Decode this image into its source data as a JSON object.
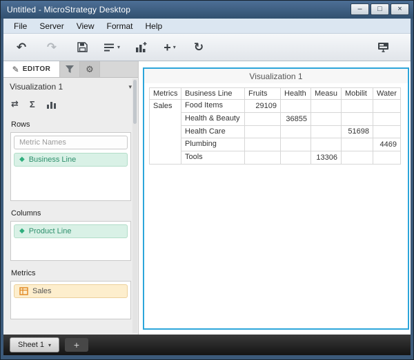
{
  "window": {
    "title": "Untitled - MicroStrategy Desktop",
    "controls": {
      "minimize": "–",
      "maximize": "□",
      "close": "×"
    }
  },
  "menu": {
    "items": [
      "File",
      "Server",
      "View",
      "Format",
      "Help"
    ]
  },
  "toolbar": {
    "icons": [
      "back",
      "forward",
      "save",
      "dataset",
      "insert-visualization",
      "add",
      "refresh",
      "presentation"
    ]
  },
  "icons": {
    "caret_down": "▾",
    "diamond": "◆",
    "pencil": "✎",
    "gear": "⚙",
    "back_arrow": "↶",
    "forward_arrow": "↷",
    "refresh": "↻",
    "plus": "+",
    "swap": "⇄",
    "sigma": "Σ"
  },
  "editor": {
    "tab_label": "EDITOR",
    "visualization_selector": "Visualization 1",
    "rows": {
      "label": "Rows",
      "items": [
        {
          "label": "Metric Names",
          "type": "placeholder"
        },
        {
          "label": "Business Line",
          "type": "attribute"
        }
      ]
    },
    "columns": {
      "label": "Columns",
      "items": [
        {
          "label": "Product Line",
          "type": "attribute"
        }
      ]
    },
    "metrics": {
      "label": "Metrics",
      "items": [
        {
          "label": "Sales",
          "type": "metric"
        }
      ]
    }
  },
  "visualization": {
    "title": "Visualization 1",
    "grid": {
      "corner_header": "Metrics",
      "row_dimension_header": "Business Line",
      "columns": [
        "Fruits",
        "Health",
        "Measu",
        "Mobilit",
        "Water"
      ],
      "metric_label": "Sales",
      "rows": [
        {
          "business_line": "Food Items",
          "values": [
            "29109",
            "",
            "",
            "",
            ""
          ]
        },
        {
          "business_line": "Health & Beauty",
          "values": [
            "",
            "36855",
            "",
            "",
            ""
          ]
        },
        {
          "business_line": "Health Care",
          "values": [
            "",
            "",
            "",
            "51698",
            ""
          ]
        },
        {
          "business_line": "Plumbing",
          "values": [
            "",
            "",
            "",
            "",
            "4469"
          ]
        },
        {
          "business_line": "Tools",
          "values": [
            "",
            "",
            "13306",
            "",
            ""
          ]
        }
      ]
    }
  },
  "sheet_bar": {
    "tab_label": "Sheet 1",
    "add_label": "+"
  }
}
